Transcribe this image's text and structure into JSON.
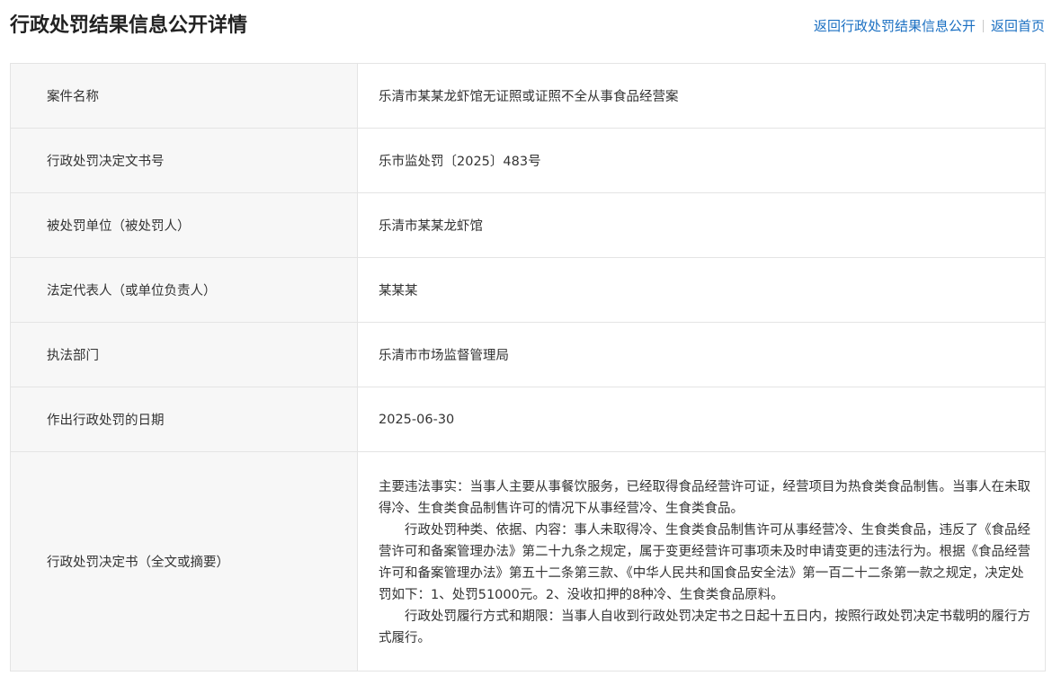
{
  "header": {
    "title": "行政处罚结果信息公开详情",
    "links": {
      "back_to_list": "返回行政处罚结果信息公开",
      "back_to_home": "返回首页"
    }
  },
  "rows": [
    {
      "label": "案件名称",
      "value": "乐清市某某龙虾馆无证照或证照不全从事食品经营案"
    },
    {
      "label": "行政处罚决定文书号",
      "value": "乐市监处罚〔2025〕483号"
    },
    {
      "label": "被处罚单位（被处罚人）",
      "value": "乐清市某某龙虾馆"
    },
    {
      "label": "法定代表人（或单位负责人）",
      "value": "某某某"
    },
    {
      "label": "执法部门",
      "value": "乐清市市场监督管理局"
    },
    {
      "label": "作出行政处罚的日期",
      "value": "2025-06-30"
    }
  ],
  "decision": {
    "label": "行政处罚决定书（全文或摘要）",
    "paragraphs": [
      "主要违法事实：当事人主要从事餐饮服务，已经取得食品经营许可证，经营项目为热食类食品制售。当事人在未取得冷、生食类食品制售许可的情况下从事经营冷、生食类食品。",
      "行政处罚种类、依据、内容：事人未取得冷、生食类食品制售许可从事经营冷、生食类食品，违反了《食品经营许可和备案管理办法》第二十九条之规定，属于变更经营许可事项未及时申请变更的违法行为。根据《食品经营许可和备案管理办法》第五十二条第三款、《中华人民共和国食品安全法》第一百二十二条第一款之规定，决定处罚如下：1、处罚51000元。2、没收扣押的8种冷、生食类食品原料。",
      "行政处罚履行方式和期限：当事人自收到行政处罚决定书之日起十五日内，按照行政处罚决定书载明的履行方式履行。"
    ]
  }
}
